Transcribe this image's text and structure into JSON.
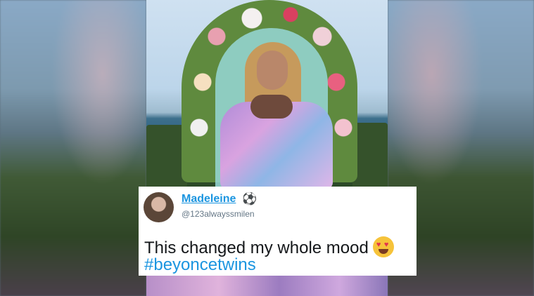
{
  "tweet": {
    "display_name": "Madeleine",
    "name_icon": "soccer-ball-icon",
    "handle": "@123alwayssmilen",
    "text": "This changed my whole mood",
    "text_emoji": "heart-eyes-icon",
    "hashtag": "#beyoncetwins"
  },
  "colors": {
    "link_blue": "#1b95e0",
    "handle_gray": "#657786",
    "text_dark": "#14171a"
  }
}
